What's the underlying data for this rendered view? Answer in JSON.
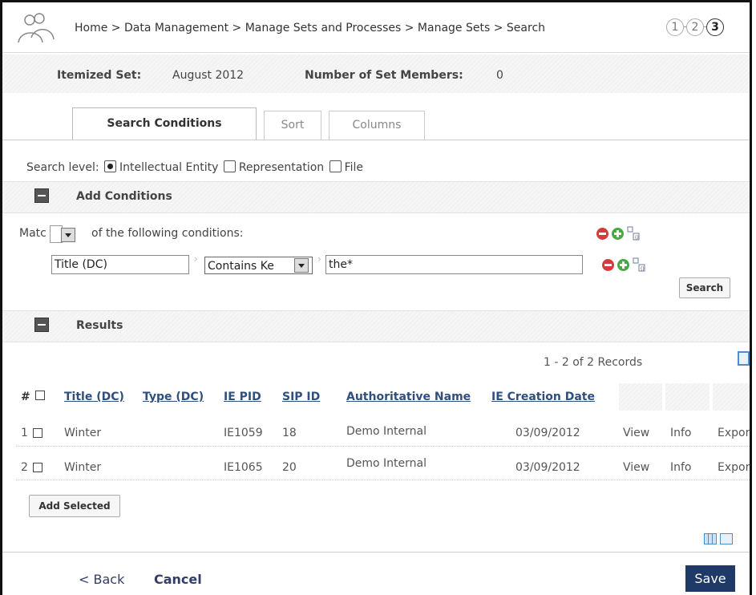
{
  "breadcrumb": "Home > Data Management > Manage Sets and Processes > Manage Sets > Search",
  "steps": [
    "1",
    "2",
    "3"
  ],
  "set_info": {
    "itemized_label": "Itemized Set:",
    "itemized_value": "August 2012",
    "members_label": "Number of Set Members:",
    "members_value": "0"
  },
  "tabs": [
    "Search Conditions",
    "Sort",
    "Columns"
  ],
  "search_level": {
    "label": "Search level:",
    "options": [
      "Intellectual Entity",
      "Representation",
      "File"
    ],
    "selected": "Intellectual Entity"
  },
  "add_conditions": {
    "title": "Add Conditions",
    "match_prefix": "Matc",
    "match_suffix": "of the following conditions:",
    "field": "Title (DC)",
    "operator": "Contains Ke",
    "value": "the*",
    "search_button": "Search"
  },
  "results": {
    "title": "Results",
    "records": "1 - 2 of 2 Records",
    "columns": [
      "#",
      "Title (DC)",
      "Type (DC)",
      "IE PID",
      "SIP ID",
      "Authoritative Name",
      "IE Creation Date"
    ],
    "rows": [
      {
        "num": "1",
        "title": "Winter",
        "type": "",
        "ie_pid": "IE1059",
        "sip_id": "18",
        "auth_name": "Demo Internal",
        "date": "03/09/2012",
        "view": "View",
        "info": "Info",
        "export": "Expor"
      },
      {
        "num": "2",
        "title": "Winter",
        "type": "",
        "ie_pid": "IE1065",
        "sip_id": "20",
        "auth_name": "Demo Internal",
        "date": "03/09/2012",
        "view": "View",
        "info": "Info",
        "export": "Expor"
      }
    ],
    "add_selected": "Add Selected"
  },
  "footer": {
    "back": "< Back",
    "cancel": "Cancel",
    "save": "Save"
  },
  "colors": {
    "save_bg": "#1f3a66",
    "link": "#2f4f7f",
    "delete_icon": "#d43b3b",
    "add_icon": "#49a845"
  }
}
